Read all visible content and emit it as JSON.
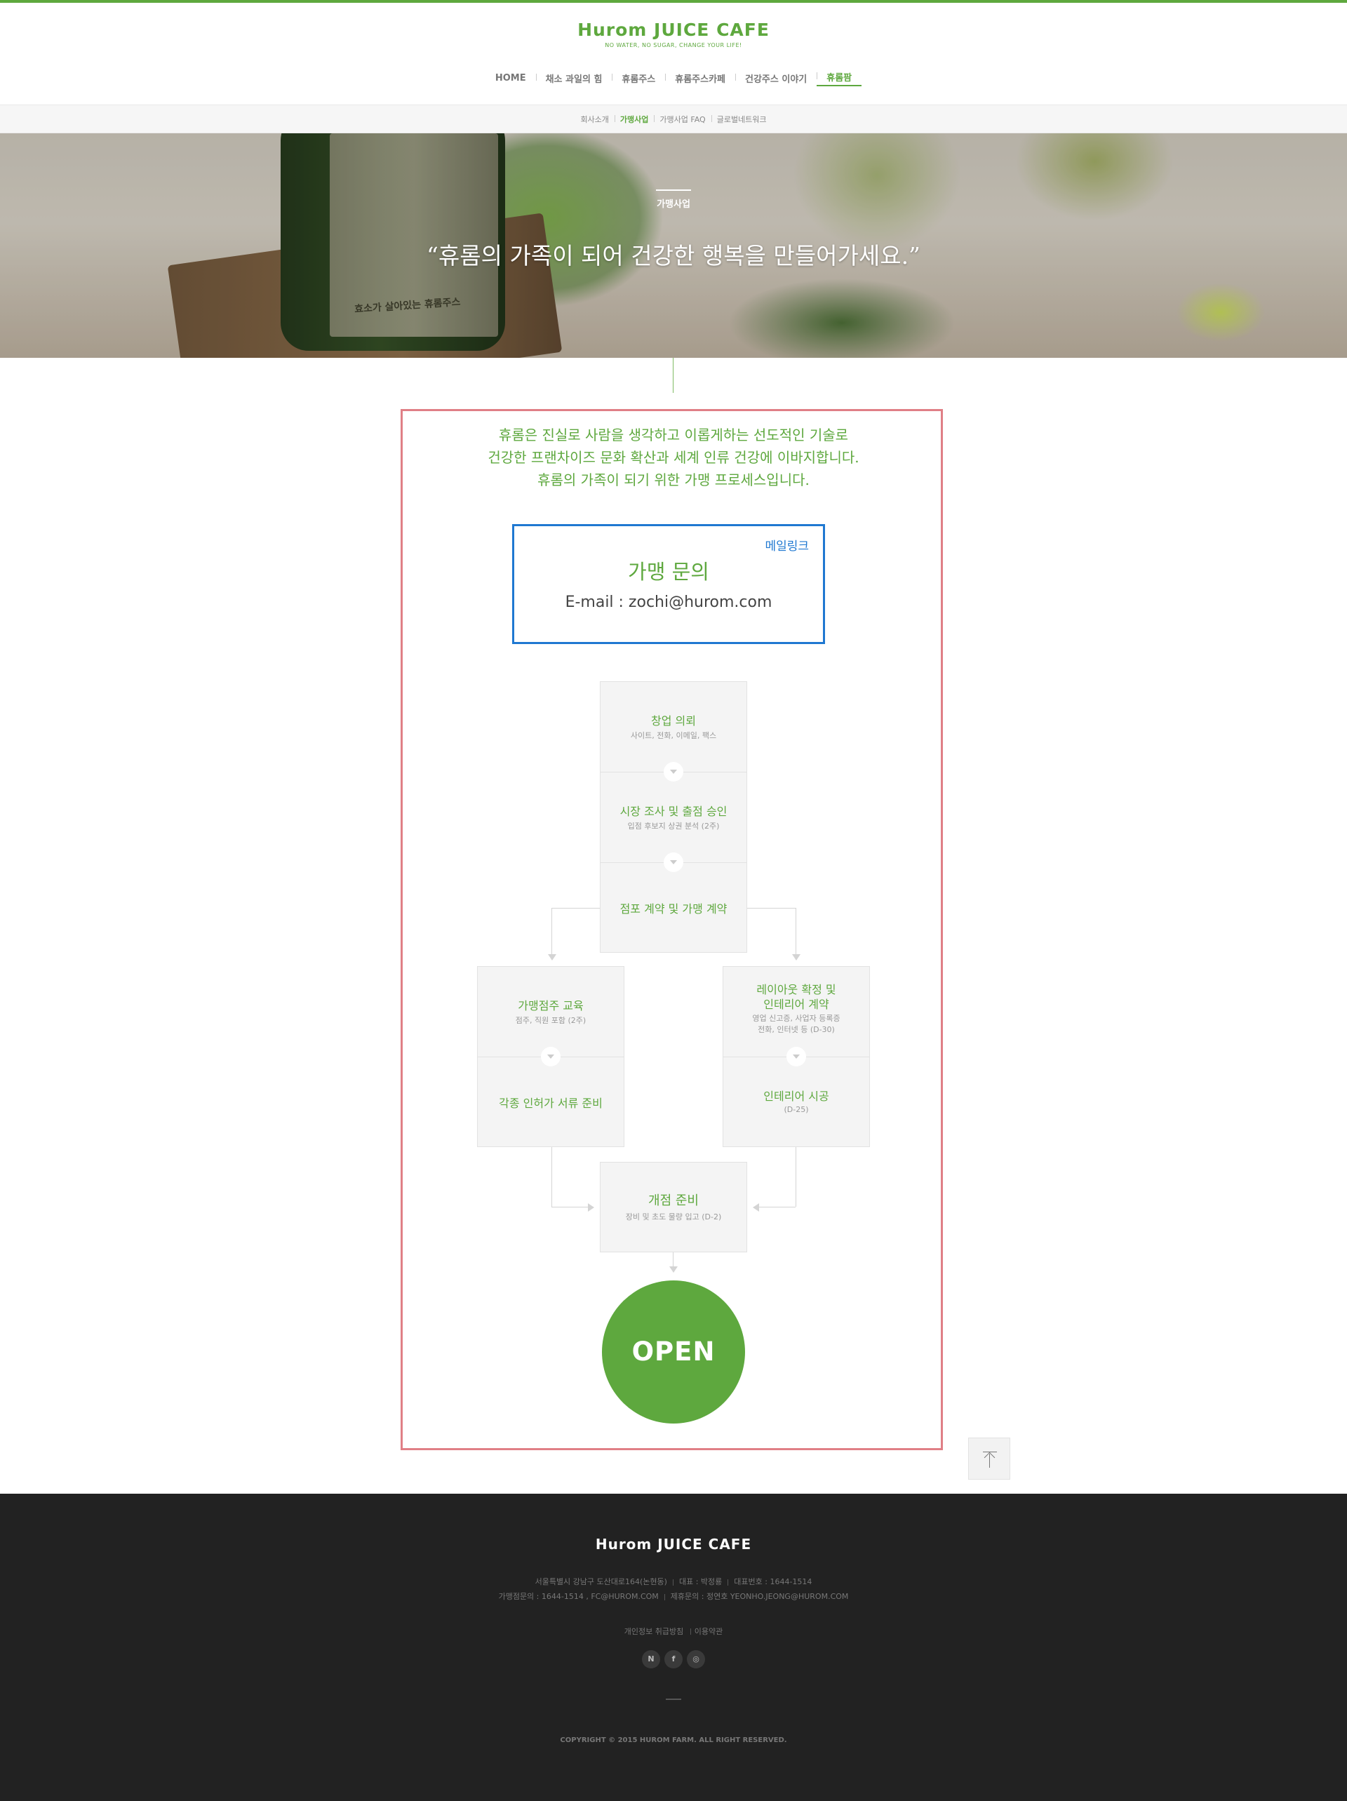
{
  "header": {
    "logo": "Hurom JUICE CAFE",
    "tagline": "NO WATER, NO SUGAR, CHANGE YOUR LIFE!",
    "nav": [
      "HOME",
      "채소 과일의 힘",
      "휴롬주스",
      "휴롬주스카페",
      "건강주스 이야기",
      "휴롬팜"
    ],
    "subnav": [
      "회사소개",
      "가맹사업",
      "가맹사업 FAQ",
      "글로벌네트워크"
    ]
  },
  "hero": {
    "kicker": "가맹사업",
    "quote": "“휴롬의 가족이 되어 건강한 행복을 만들어가세요.”",
    "bottle_label": "효소가 살아있는 휴롬주스"
  },
  "intro": [
    "휴롬은 진실로 사람을 생각하고 이롭게하는 선도적인 기술로",
    "건강한 프랜차이즈 문화 확산과 세계 인류 건강에 이바지합니다.",
    "휴롬의 가족이 되기 위한 가맹 프로세스입니다."
  ],
  "inquiry": {
    "maillink": "메일링크",
    "title": "가맹 문의",
    "email": "E-mail : zochi@hurom.com"
  },
  "process": {
    "step1": {
      "title": "창업 의뢰",
      "desc": "사이트, 전화, 이메일, 팩스"
    },
    "step2": {
      "title": "시장 조사 및 출점 승인",
      "desc": "입점 후보지 상권 분석 (2주)"
    },
    "step3": {
      "title": "점포 계약 및 가맹 계약"
    },
    "left1": {
      "title": "가맹점주 교육",
      "desc": "점주, 직원 포함 (2주)"
    },
    "left2": {
      "title": "각종 인허가 서류 준비"
    },
    "right1": {
      "title_l1": "레이아웃 확정 및",
      "title_l2": "인테리어 계약",
      "desc_l1": "영업 신고증, 사업자 등록증",
      "desc_l2": "전화, 인터넷 등 (D-30)"
    },
    "right2": {
      "title": "인테리어 시공",
      "desc": "(D-25)"
    },
    "step4": {
      "title": "개점 준비",
      "desc": "장비 및 초도 물량 입고 (D-2)"
    },
    "open": "OPEN"
  },
  "footer": {
    "logo": "Hurom JUICE CAFE",
    "address": "서울특별시 강남구 도산대로164(논현동)",
    "ceo": "대표 : 박정룡",
    "phone": "대표번호 : 1644-1514",
    "franchise": "가맹점문의 : 1644-1514 , FC@HUROM.COM",
    "partner": "제휴문의 : 정연호 YEONHO.JEONG@HUROM.COM",
    "links": [
      "개인정보 취급방침",
      "이용약관"
    ],
    "sns": [
      "N",
      "f",
      "◎"
    ],
    "copyright": "COPYRIGHT © 2015 HUROM FARM. ALL RIGHT RESERVED."
  },
  "colors": {
    "brand": "#5ea83e",
    "frame": "#e07f86",
    "inquiry_border": "#1f78d1",
    "footer_bg": "#222222"
  }
}
